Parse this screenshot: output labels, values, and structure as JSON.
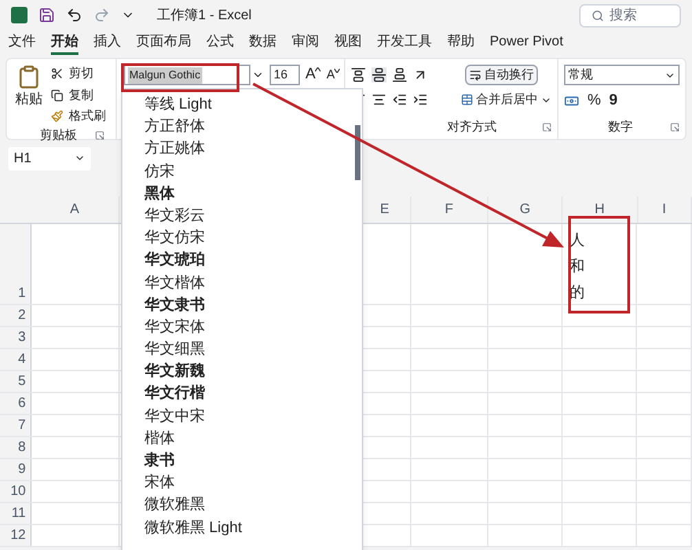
{
  "title_bar": {
    "title": "工作簿1 - Excel",
    "search_placeholder": "搜索"
  },
  "menu_tabs": [
    {
      "label": "文件",
      "selected": false
    },
    {
      "label": "开始",
      "selected": true
    },
    {
      "label": "插入",
      "selected": false
    },
    {
      "label": "页面布局",
      "selected": false
    },
    {
      "label": "公式",
      "selected": false
    },
    {
      "label": "数据",
      "selected": false
    },
    {
      "label": "审阅",
      "selected": false
    },
    {
      "label": "视图",
      "selected": false
    },
    {
      "label": "开发工具",
      "selected": false
    },
    {
      "label": "帮助",
      "selected": false
    },
    {
      "label": "Power Pivot",
      "selected": false
    }
  ],
  "ribbon": {
    "clipboard": {
      "paste": "粘贴",
      "cut": "剪切",
      "copy": "复制",
      "format_painter": "格式刷",
      "group_label": "剪贴板"
    },
    "font": {
      "font_name": "Malgun Gothic",
      "font_size": "16",
      "grow_font": "A",
      "shrink_font": "A"
    },
    "alignment": {
      "wrap_text": "自动换行",
      "merge_center": "合并后居中",
      "group_label": "对齐方式"
    },
    "number": {
      "format": "常规",
      "percent": "%",
      "comma": "9",
      "group_label": "数字"
    }
  },
  "formula_bar": {
    "name_box": "H1"
  },
  "font_dropdown": {
    "items": [
      {
        "label": "等线 Light",
        "bold": false
      },
      {
        "label": "方正舒体",
        "bold": false
      },
      {
        "label": "方正姚体",
        "bold": false
      },
      {
        "label": "仿宋",
        "bold": false
      },
      {
        "label": "黑体",
        "bold": true
      },
      {
        "label": "华文彩云",
        "bold": false
      },
      {
        "label": "华文仿宋",
        "bold": false
      },
      {
        "label": "华文琥珀",
        "bold": true
      },
      {
        "label": "华文楷体",
        "bold": false
      },
      {
        "label": "华文隶书",
        "bold": true
      },
      {
        "label": "华文宋体",
        "bold": false
      },
      {
        "label": "华文细黑",
        "bold": false
      },
      {
        "label": "华文新魏",
        "bold": true
      },
      {
        "label": "华文行楷",
        "bold": true
      },
      {
        "label": "华文中宋",
        "bold": false
      },
      {
        "label": "楷体",
        "bold": false
      },
      {
        "label": "隶书",
        "bold": true
      },
      {
        "label": "宋体",
        "bold": false
      },
      {
        "label": "微软雅黑",
        "bold": false
      },
      {
        "label": "微软雅黑 Light",
        "bold": false
      }
    ]
  },
  "sheet": {
    "columns": [
      "A",
      "E",
      "F",
      "G",
      "H",
      "I"
    ],
    "rows": [
      "1",
      "2",
      "3",
      "4",
      "5",
      "6",
      "7",
      "8",
      "9",
      "10",
      "11",
      "12"
    ],
    "h1_cell": {
      "lines": [
        "人",
        "和",
        "的"
      ]
    }
  }
}
